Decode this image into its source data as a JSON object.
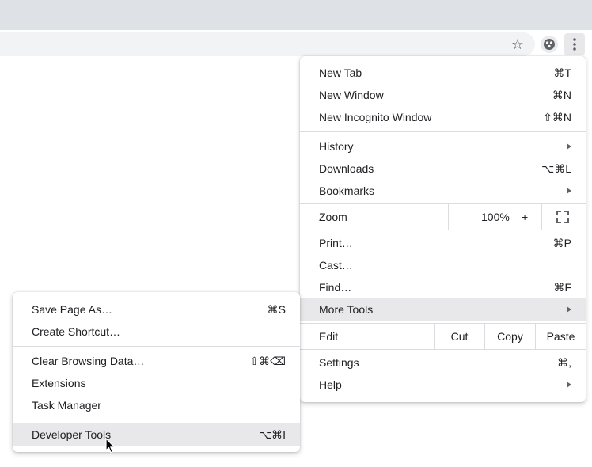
{
  "browser": {
    "bookmark_icon": "star-icon",
    "extension_icon": "extension-icon",
    "menu_icon": "kebab-menu-icon"
  },
  "main_menu": {
    "new_tab": {
      "label": "New Tab",
      "shortcut": "⌘T"
    },
    "new_window": {
      "label": "New Window",
      "shortcut": "⌘N"
    },
    "new_incognito": {
      "label": "New Incognito Window",
      "shortcut": "⇧⌘N"
    },
    "history": {
      "label": "History"
    },
    "downloads": {
      "label": "Downloads",
      "shortcut": "⌥⌘L"
    },
    "bookmarks": {
      "label": "Bookmarks"
    },
    "zoom": {
      "label": "Zoom",
      "minus": "–",
      "level": "100%",
      "plus": "+"
    },
    "print": {
      "label": "Print…",
      "shortcut": "⌘P"
    },
    "cast": {
      "label": "Cast…"
    },
    "find": {
      "label": "Find…",
      "shortcut": "⌘F"
    },
    "more_tools": {
      "label": "More Tools"
    },
    "edit": {
      "label": "Edit",
      "cut": "Cut",
      "copy": "Copy",
      "paste": "Paste"
    },
    "settings": {
      "label": "Settings",
      "shortcut": "⌘,"
    },
    "help": {
      "label": "Help"
    }
  },
  "sub_menu": {
    "save_page": {
      "label": "Save Page As…",
      "shortcut": "⌘S"
    },
    "create_shortcut": {
      "label": "Create Shortcut…"
    },
    "clear_browsing": {
      "label": "Clear Browsing Data…",
      "shortcut": "⇧⌘⌫"
    },
    "extensions": {
      "label": "Extensions"
    },
    "task_manager": {
      "label": "Task Manager"
    },
    "developer_tools": {
      "label": "Developer Tools",
      "shortcut": "⌥⌘I"
    }
  },
  "colors": {
    "tabstrip": "#dee1e6",
    "highlight": "#e8e8ea",
    "separator": "#dadce0",
    "icon": "#5f6368"
  }
}
